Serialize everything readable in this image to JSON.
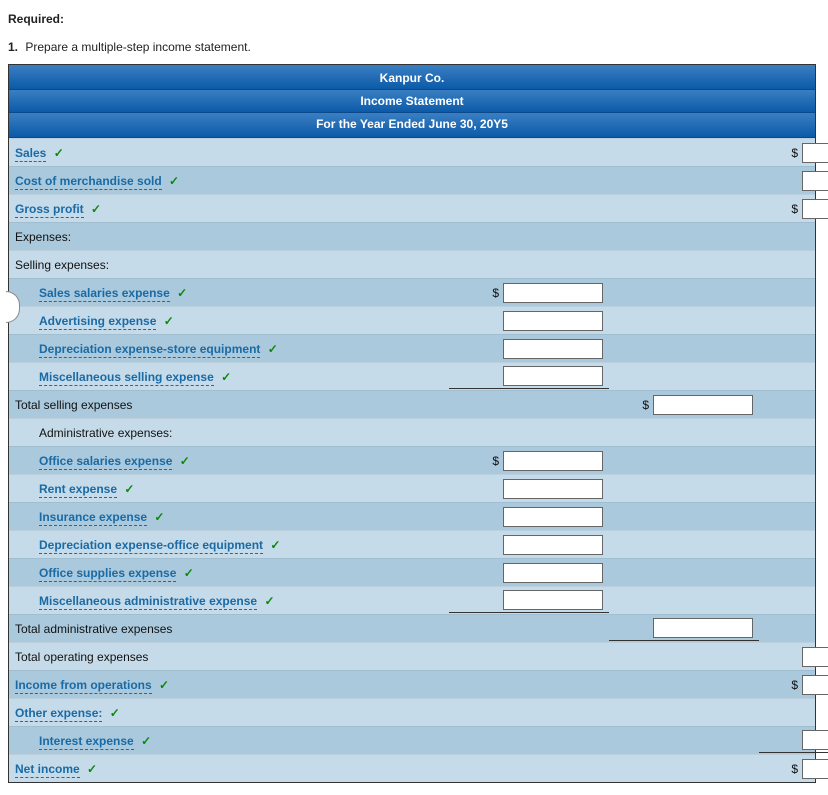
{
  "heading": "Required:",
  "instruction_number": "1.",
  "instruction_text": "Prepare a multiple-step income statement.",
  "header": {
    "company": "Kanpur Co.",
    "title": "Income Statement",
    "period": "For the Year Ended June 30, 20Y5"
  },
  "rows": {
    "sales": "Sales",
    "cogs": "Cost of merchandise sold",
    "gross_profit": "Gross profit",
    "expenses": "Expenses:",
    "selling_expenses": "Selling expenses:",
    "sales_salaries": "Sales salaries expense",
    "advertising": "Advertising expense",
    "dep_store": "Depreciation expense-store equipment",
    "misc_selling": "Miscellaneous selling expense",
    "total_selling": "Total selling expenses",
    "admin_expenses": "Administrative expenses:",
    "office_salaries": "Office salaries expense",
    "rent": "Rent expense",
    "insurance": "Insurance expense",
    "dep_office": "Depreciation expense-office equipment",
    "office_supplies": "Office supplies expense",
    "misc_admin": "Miscellaneous administrative expense",
    "total_admin": "Total administrative expenses",
    "total_operating": "Total operating expenses",
    "income_ops": "Income from operations",
    "other_expense": "Other expense:",
    "interest": "Interest expense",
    "net_income": "Net income"
  },
  "dollar": "$",
  "check": "✓"
}
